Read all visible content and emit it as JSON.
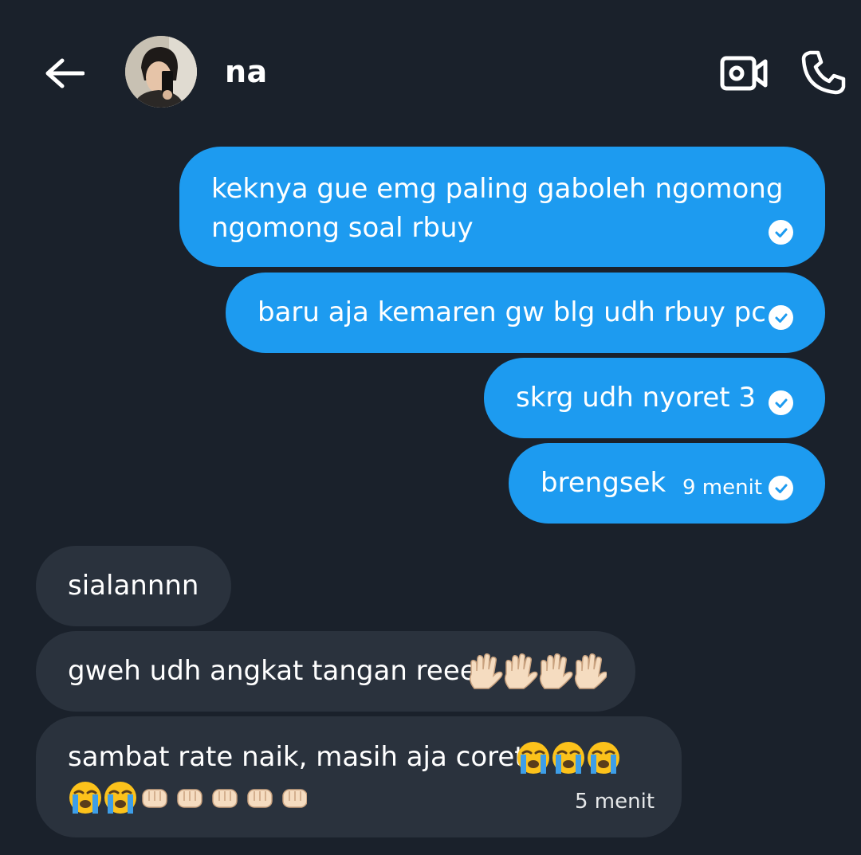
{
  "header": {
    "contact_name": "na",
    "back_icon": "arrow-left-icon",
    "video_icon": "video-camera-icon",
    "call_icon": "phone-icon"
  },
  "messages": [
    {
      "direction": "out",
      "lines": [
        "keknya gue emg paling gaboleh ngomong",
        "ngomong soal rbuy"
      ],
      "status": "read"
    },
    {
      "direction": "out",
      "text": "baru aja kemaren gw blg udh rbuy pc",
      "status": "read"
    },
    {
      "direction": "out",
      "text": "skrg udh nyoret 3",
      "status": "read"
    },
    {
      "direction": "out",
      "text": "brengsek",
      "time": "9 menit",
      "status": "read"
    },
    {
      "direction": "in",
      "text": "sialannnn"
    },
    {
      "direction": "in",
      "text": "gweh udh angkat tangan reee",
      "emoji": "raised-hand x4"
    },
    {
      "direction": "in",
      "text": "sambat rate naik, masih aja coret",
      "emoji": "loudly-crying-face x5, oncoming-fist x5",
      "time": "5 menit"
    }
  ],
  "colors": {
    "background": "#1a212b",
    "outgoing_bubble": "#1d9bf0",
    "incoming_bubble": "#2a323d",
    "text": "#ffffff"
  }
}
